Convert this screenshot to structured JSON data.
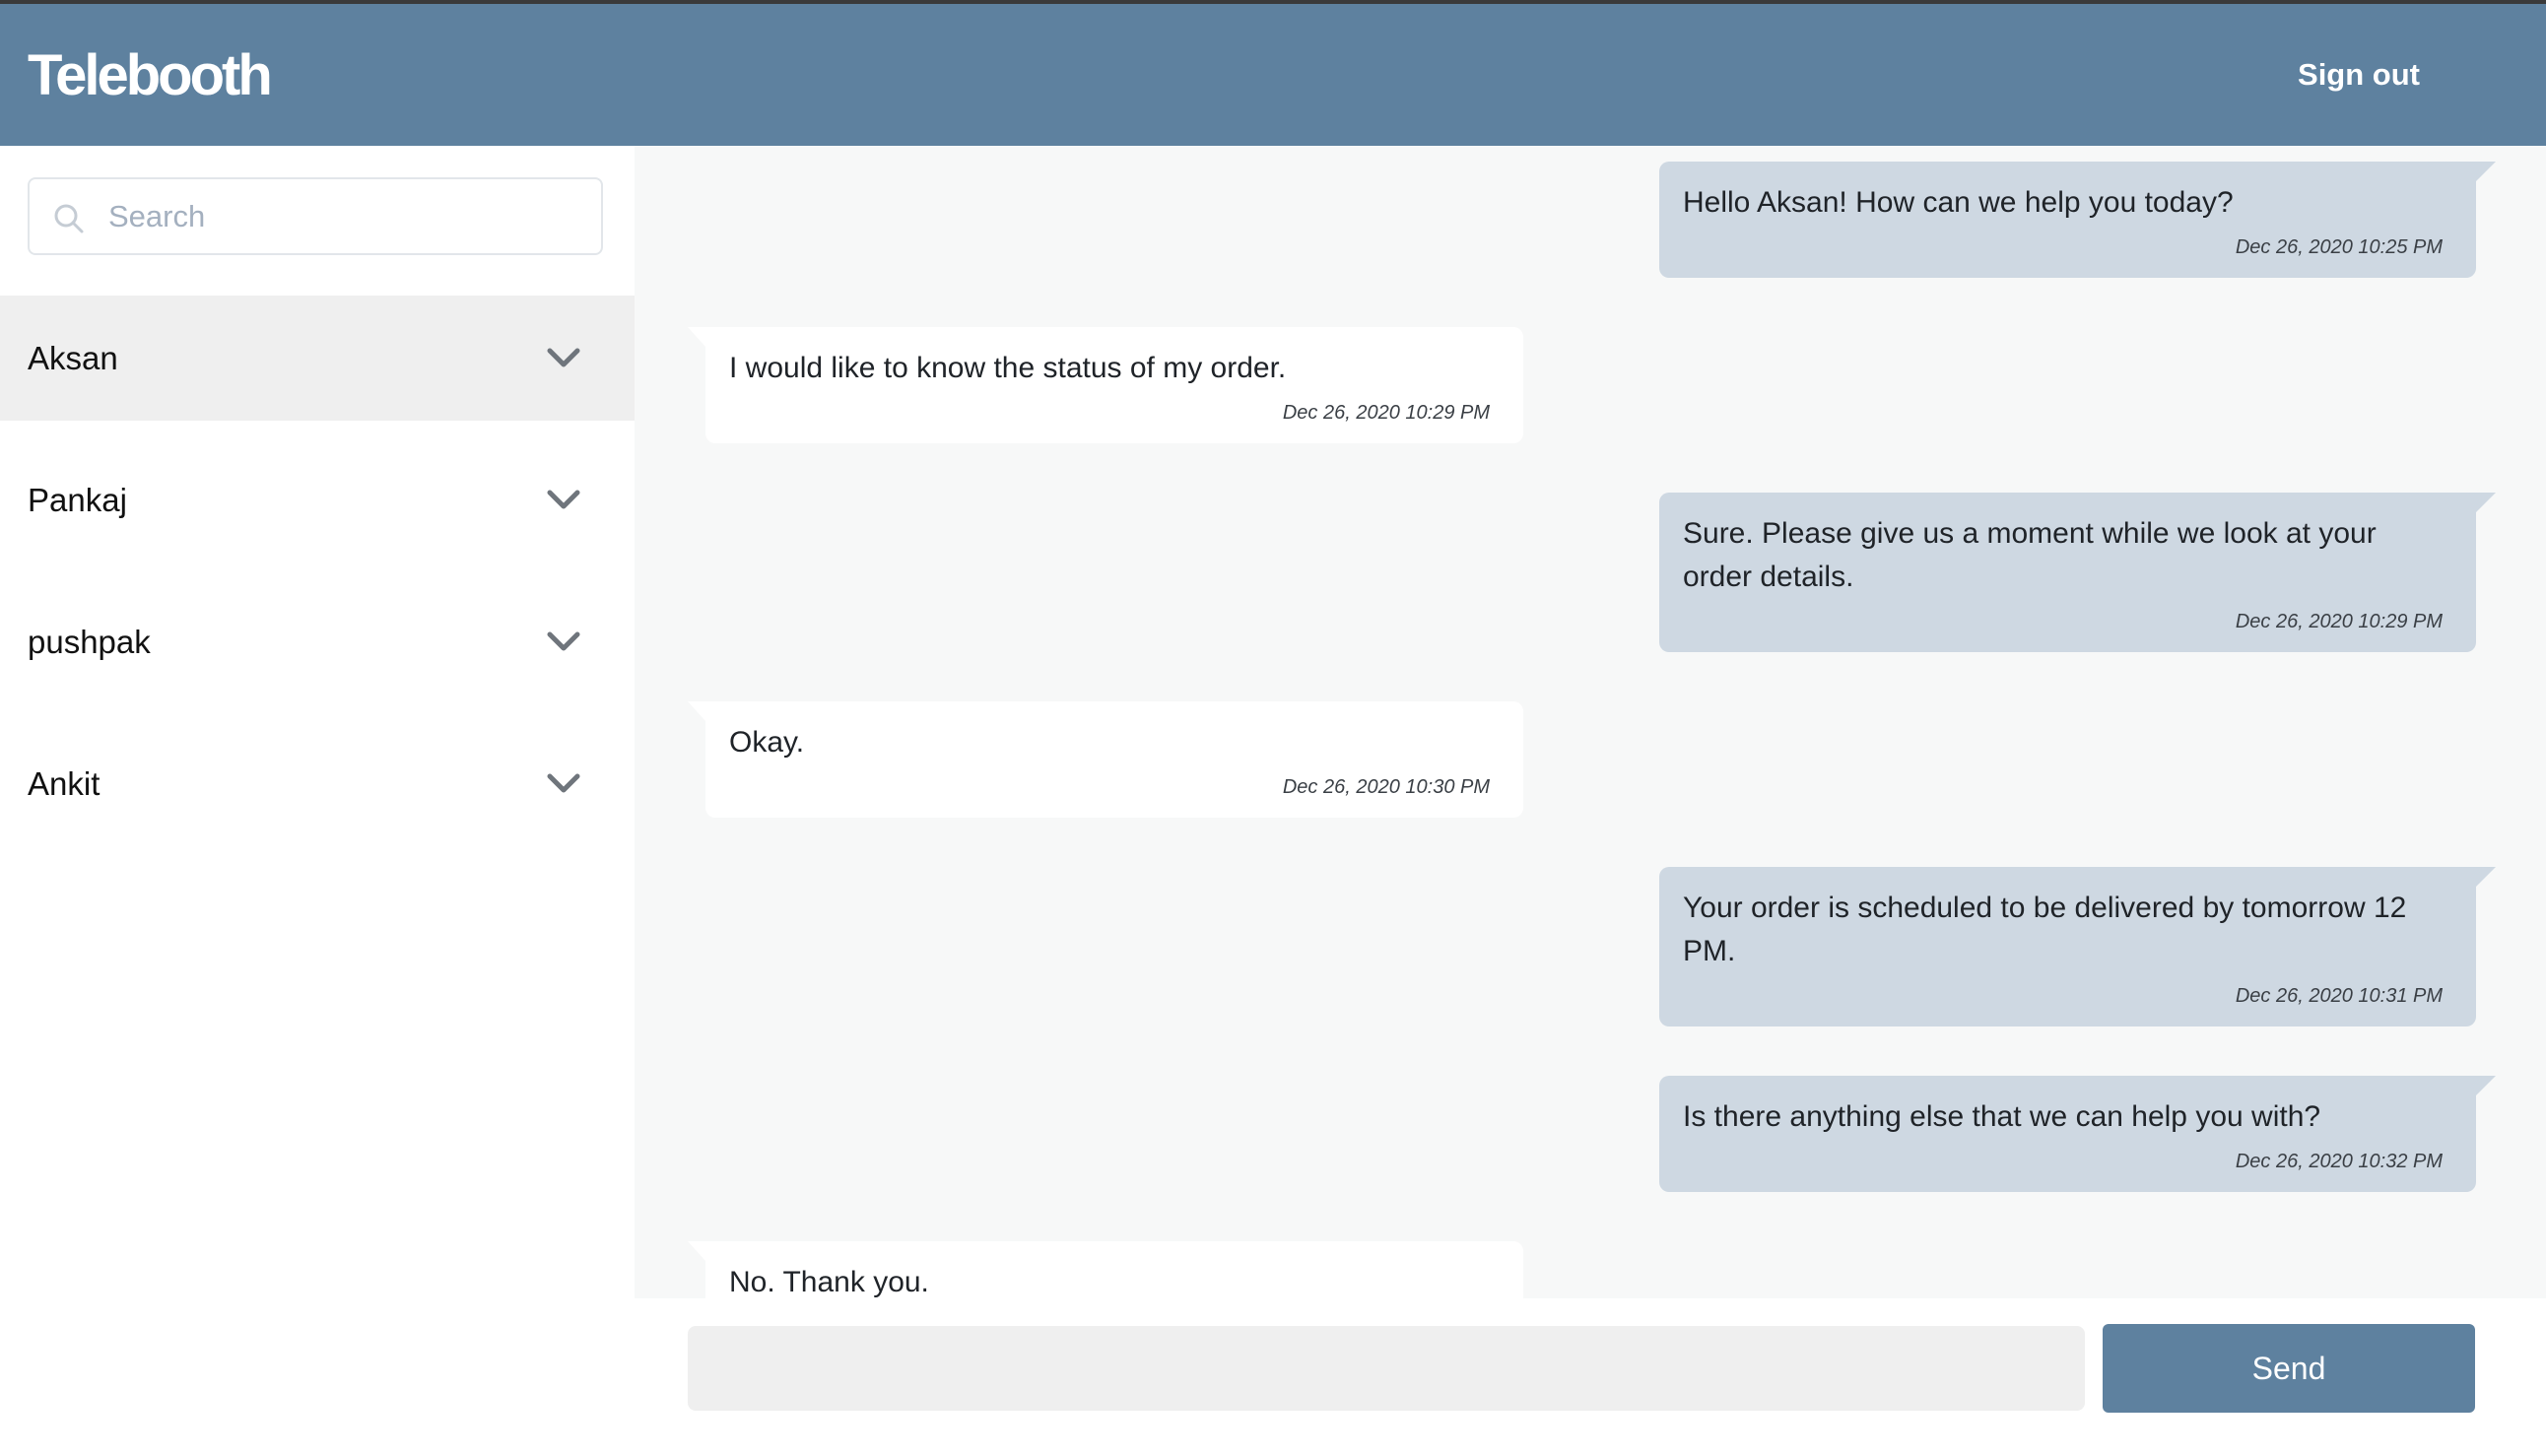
{
  "app": {
    "title": "Telebooth",
    "sign_out_label": "Sign out"
  },
  "colors": {
    "brand": "#5e819f",
    "outgoing_bubble": "#ced8e2",
    "incoming_bubble": "#ffffff",
    "active_contact_bg": "#efefef",
    "chat_bg": "#f7f8f8"
  },
  "sidebar": {
    "search": {
      "placeholder": "Search",
      "value": "",
      "icon": "search-icon"
    },
    "contacts": [
      {
        "name": "Aksan",
        "active": true,
        "icon": "chevron-down-icon"
      },
      {
        "name": "Pankaj",
        "active": false,
        "icon": "chevron-down-icon"
      },
      {
        "name": "pushpak",
        "active": false,
        "icon": "chevron-down-icon"
      },
      {
        "name": "Ankit",
        "active": false,
        "icon": "chevron-down-icon"
      }
    ]
  },
  "chat": {
    "messages": [
      {
        "direction": "out",
        "text": "Hello Aksan! How can we help you today?",
        "time": "Dec 26, 2020 10:25 PM"
      },
      {
        "direction": "in",
        "text": "I would like to know the status of my order.",
        "time": "Dec 26, 2020 10:29 PM"
      },
      {
        "direction": "out",
        "text": "Sure. Please give us a moment while we look at your order details.",
        "time": "Dec 26, 2020 10:29 PM"
      },
      {
        "direction": "in",
        "text": "Okay.",
        "time": "Dec 26, 2020 10:30 PM"
      },
      {
        "direction": "out",
        "text": "Your order is scheduled to be delivered by tomorrow 12 PM.",
        "time": "Dec 26, 2020 10:31 PM"
      },
      {
        "direction": "out",
        "text": "Is there anything else that we can help you with?",
        "time": "Dec 26, 2020 10:32 PM"
      },
      {
        "direction": "in",
        "text": "No. Thank you.",
        "time": ""
      }
    ]
  },
  "composer": {
    "value": "",
    "placeholder": "",
    "send_label": "Send"
  }
}
